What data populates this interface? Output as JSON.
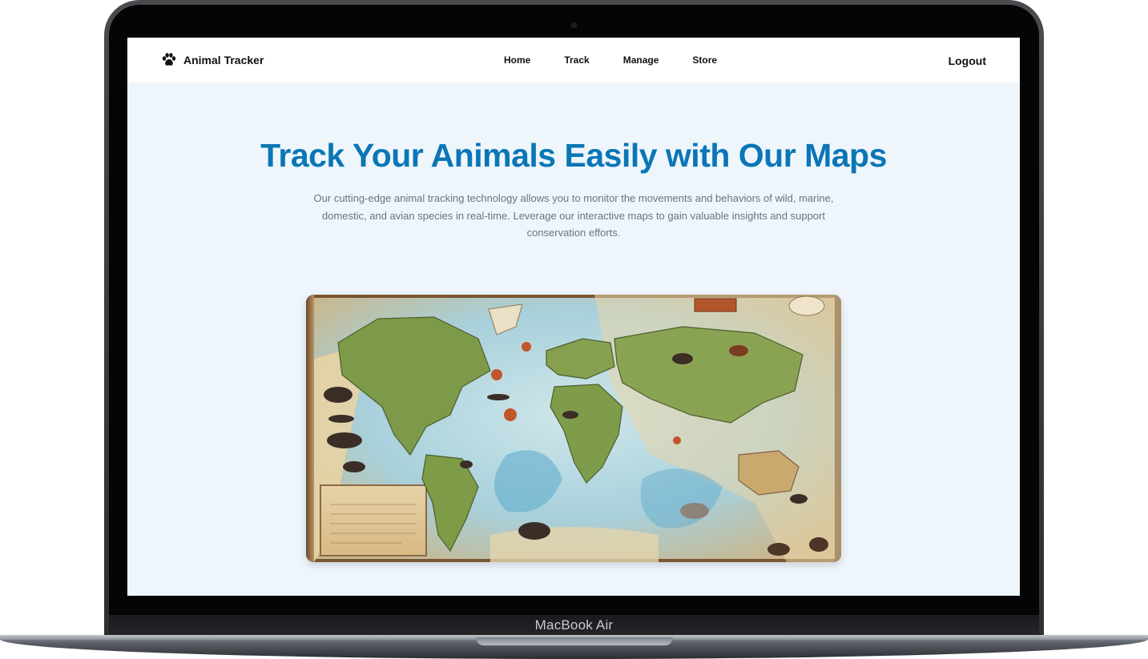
{
  "device": {
    "label": "MacBook Air"
  },
  "navbar": {
    "brand": "Animal Tracker",
    "brand_icon": "paw-icon",
    "links": [
      "Home",
      "Track",
      "Manage",
      "Store"
    ],
    "logout": "Logout"
  },
  "hero": {
    "title": "Track Your Animals Easily with Our Maps",
    "description": "Our cutting-edge animal tracking technology allows you to monitor the movements and behaviors of wild, marine, domestic, and avian species in real-time. Leverage our interactive maps to gain valuable insights and support conservation efforts."
  },
  "colors": {
    "accent": "#0a76b6",
    "background": "#eef6fc",
    "text_muted": "#6b7280"
  }
}
